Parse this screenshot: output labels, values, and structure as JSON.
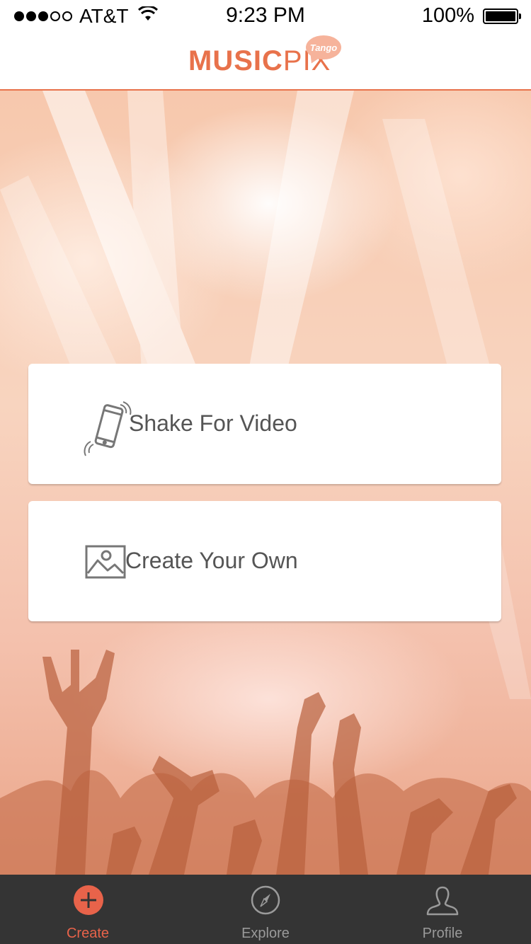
{
  "status_bar": {
    "carrier": "AT&T",
    "time": "9:23 PM",
    "battery": "100%",
    "signal_bars_filled": 3,
    "signal_bars_total": 5
  },
  "header": {
    "logo_music": "MUSIC",
    "logo_pix": "PIX",
    "logo_badge": "Tango"
  },
  "actions": {
    "shake_label": "Shake For Video",
    "create_label": "Create Your Own"
  },
  "tabs": [
    {
      "label": "Create",
      "icon": "plus-circle-icon",
      "active": true
    },
    {
      "label": "Explore",
      "icon": "compass-icon",
      "active": false
    },
    {
      "label": "Profile",
      "icon": "person-icon",
      "active": false
    }
  ],
  "colors": {
    "accent": "#e8724b",
    "tab_active": "#e8634a",
    "tab_bar_bg": "#343434",
    "card_text": "#555555"
  }
}
